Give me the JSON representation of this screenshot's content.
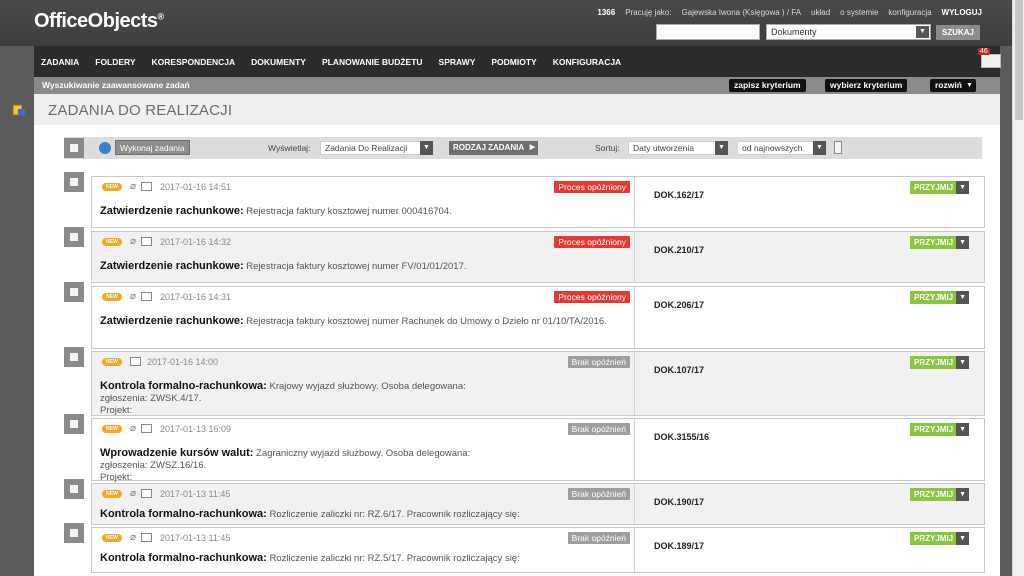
{
  "app": {
    "logo": "OfficeObjects",
    "logo_mark": "®"
  },
  "userbar": {
    "count": "1366",
    "working_as_label": "Pracuję jako:",
    "user": "Gajewska Iwona (Księgowa ) / FA",
    "links": [
      "układ",
      "o systemie",
      "konfiguracja"
    ],
    "logout": "WYLOGUJ"
  },
  "search": {
    "input_value": "",
    "select_value": "Dokumenty",
    "button": "SZUKAJ"
  },
  "nav": {
    "items": [
      "ZADANIA",
      "FOLDERY",
      "KORESPONDENCJA",
      "DOKUMENTY",
      "PLANOWANIE BUDŻETU",
      "SPRAWY",
      "PODMIOTY",
      "KONFIGURACJA"
    ]
  },
  "mail": {
    "badge": "46"
  },
  "advanced": {
    "label": "Wyszukiwanie zaawansowane zadań",
    "save": "zapisz kryterium",
    "choose": "wybierz kryterium",
    "expand": "rozwiń"
  },
  "page": {
    "title": "ZADANIA DO REALIZACJI"
  },
  "toolbar": {
    "execute": "Wykonaj zadania",
    "display_label": "Wyświetlaj:",
    "display_value": "Zadania Do Realizacji",
    "type_button": "RODZAJ ZADANIA",
    "sort_label": "Sortuj:",
    "sort_value": "Daty utworzenia",
    "order_value": "od najnowszych"
  },
  "tasks": [
    {
      "date": "2017-01-16 14:51",
      "status": "Proces opóźniony",
      "title": "Zatwierdzenie rachunkowe:",
      "desc": "Rejestracja faktury kosztowej numer 000416704.",
      "doc": "DOK.162/17",
      "action": "PRZYJMIJ"
    },
    {
      "date": "2017-01-16 14:32",
      "status": "Proces opóźniony",
      "title": "Zatwierdzenie rachunkowe:",
      "desc": "Rejestracja faktury kosztowej numer FV/01/01/2017.",
      "doc": "DOK.210/17",
      "action": "PRZYJMIJ"
    },
    {
      "date": "2017-01-16 14:31",
      "status": "Proces opóźniony",
      "title": "Zatwierdzenie rachunkowe:",
      "desc": "Rejestracja faktury kosztowej numer Rachunek do Umowy o Dzieło nr 01/10/TA/2016.",
      "doc": "DOK.206/17",
      "action": "PRZYJMIJ"
    },
    {
      "date": "2017-01-16 14:00",
      "status": "Brak opóźnień",
      "title": "Kontrola formalno-rachunkowa:",
      "desc": "Krajowy wyjazd służbowy. Osoba delegowana:",
      "desc2": "zgłoszenia: ZWSK.4/17.",
      "desc3": "Projekt:",
      "doc": "DOK.107/17",
      "action": "PRZYJMIJ"
    },
    {
      "date": "2017-01-13 16:09",
      "status": "Brak opóźnień",
      "title": "Wprowadzenie kursów walut:",
      "desc": "Zagraniczny wyjazd służbowy. Osoba delegowana:",
      "desc2": "zgłoszenia: ZWSZ.16/16.",
      "desc3": "Projekt:",
      "doc": "DOK.3155/16",
      "action": "PRZYJMIJ"
    },
    {
      "date": "2017-01-13 11:45",
      "status": "Brak opóźnień",
      "title": "Kontrola formalno-rachunkowa:",
      "desc": "Rozliczenie zaliczki nr: RZ.6/17. Pracownik rozliczający się:",
      "doc": "DOK.190/17",
      "action": "PRZYJMIJ"
    },
    {
      "date": "2017-01-13 11:45",
      "status": "Brak opóźnień",
      "title": "Kontrola formalno-rachunkowa:",
      "desc": "Rozliczenie zaliczki nr: RZ.5/17. Pracownik rozliczający się:",
      "doc": "DOK.189/17",
      "action": "PRZYJMIJ"
    }
  ]
}
